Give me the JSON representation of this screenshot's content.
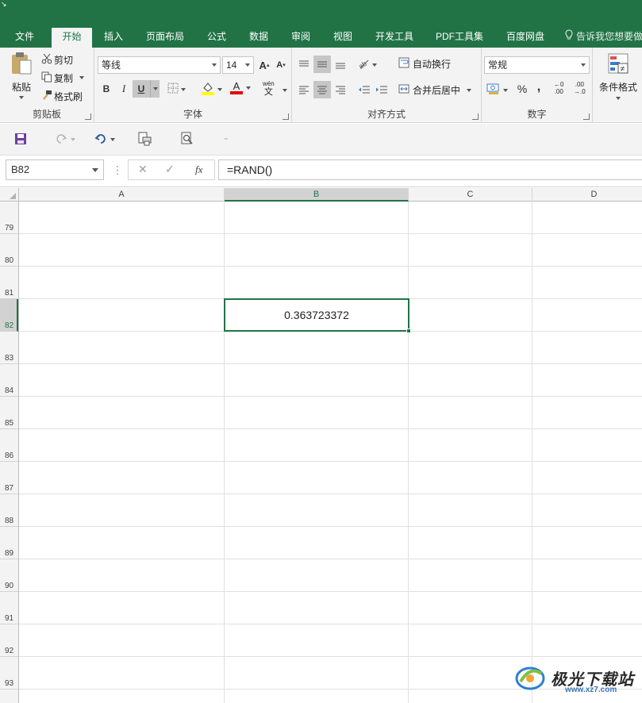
{
  "colors": {
    "brand_green": "#217346",
    "ribbon_bg": "#f3f3f3",
    "selected_header": "#d2d2d2"
  },
  "title_bar": {
    "corner_glyph": "↘"
  },
  "tabs": [
    {
      "label": "文件",
      "active": false
    },
    {
      "label": "开始",
      "active": true
    },
    {
      "label": "插入",
      "active": false
    },
    {
      "label": "页面布局",
      "active": false
    },
    {
      "label": "公式",
      "active": false
    },
    {
      "label": "数据",
      "active": false
    },
    {
      "label": "审阅",
      "active": false
    },
    {
      "label": "视图",
      "active": false
    },
    {
      "label": "开发工具",
      "active": false
    },
    {
      "label": "PDF工具集",
      "active": false
    },
    {
      "label": "百度网盘",
      "active": false
    }
  ],
  "tell_me": {
    "text": "告诉我您想要做",
    "icon": "lightbulb-icon"
  },
  "ribbon": {
    "clipboard": {
      "label": "剪贴板",
      "paste_label": "粘贴",
      "cut_label": "剪切",
      "copy_label": "复制",
      "format_painter_label": "格式刷"
    },
    "font": {
      "label": "字体",
      "font_name": "等线",
      "font_size": "14",
      "grow_label": "A",
      "shrink_label": "A",
      "bold_label": "B",
      "italic_label": "I",
      "underline_label": "U",
      "font_color_label": "A",
      "phonetic_label": "wén",
      "phonetic_sub": "文"
    },
    "alignment": {
      "label": "对齐方式",
      "wrap_label": "自动换行",
      "merge_label": "合并后居中"
    },
    "number": {
      "label": "数字",
      "format": "常规",
      "percent_label": "%",
      "comma_label": ",",
      "inc_decimal_top": "←0",
      "inc_decimal_bottom": ".00",
      "dec_decimal_top": ".00",
      "dec_decimal_bottom": "→.0"
    },
    "styles": {
      "conditional_format_label": "条件格式"
    }
  },
  "quick_access": {
    "save_icon": "save-icon",
    "redo_icon": "redo-icon",
    "undo_icon": "undo-icon",
    "print_preview_icon": "print-preview-icon",
    "find_icon": "find-icon",
    "customize_glyph": "⁼"
  },
  "formula_bar": {
    "name_box": "B82",
    "separator": "⋮",
    "cancel_glyph": "✕",
    "enter_glyph": "✓",
    "fx_label": "fx",
    "formula": "=RAND()"
  },
  "grid": {
    "columns": [
      "A",
      "B",
      "C",
      "D"
    ],
    "selected_column": "B",
    "rows": [
      "79",
      "80",
      "81",
      "82",
      "83",
      "84",
      "85",
      "86",
      "87",
      "88",
      "89",
      "90",
      "91",
      "92",
      "93"
    ],
    "selected_row": "82",
    "active_cell": {
      "ref": "B82",
      "value": "0.363723372"
    }
  },
  "watermark": {
    "text": "极光下载站",
    "domain": "www.xz7.com"
  }
}
